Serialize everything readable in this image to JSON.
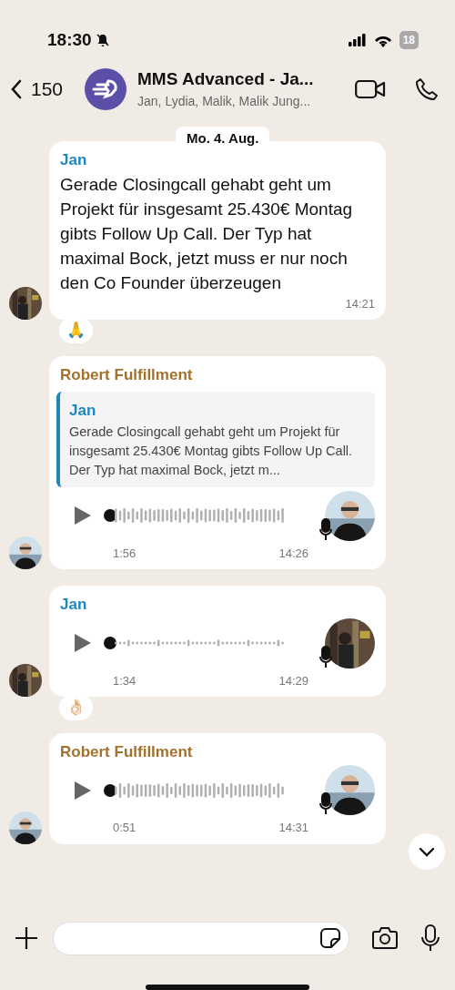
{
  "status_bar": {
    "time": "18:30",
    "battery": "18"
  },
  "header": {
    "back_count": "150",
    "title": "MMS Advanced - Ja...",
    "subtitle": "Jan, Lydia, Malik, Malik Jung..."
  },
  "date_chip": "Mo. 4. Aug.",
  "messages": [
    {
      "kind": "text",
      "sender": "Jan",
      "color": "#1d86bd",
      "text": "Gerade Closingcall gehabt geht um Projekt für insgesamt 25.430€ Montag gibts Follow Up Call. Der Typ hat maximal Bock, jetzt muss er nur noch den Co Founder überzeugen",
      "time": "14:21",
      "reaction": "🙏"
    },
    {
      "kind": "voice",
      "sender": "Robert Fulfillment",
      "color": "#a4712c",
      "quote": {
        "sender": "Jan",
        "text": "Gerade Closingcall gehabt geht um Projekt für insgesamt 25.430€ Montag gibts Follow Up Call. Der Typ hat maximal Bock, jetzt m..."
      },
      "duration": "1:56",
      "time": "14:26"
    },
    {
      "kind": "voice",
      "sender": "Jan",
      "color": "#1d86bd",
      "duration": "1:34",
      "time": "14:29",
      "reaction": "👌🏻"
    },
    {
      "kind": "voice",
      "sender": "Robert Fulfillment",
      "color": "#a4712c",
      "duration": "0:51",
      "time": "14:31"
    }
  ]
}
